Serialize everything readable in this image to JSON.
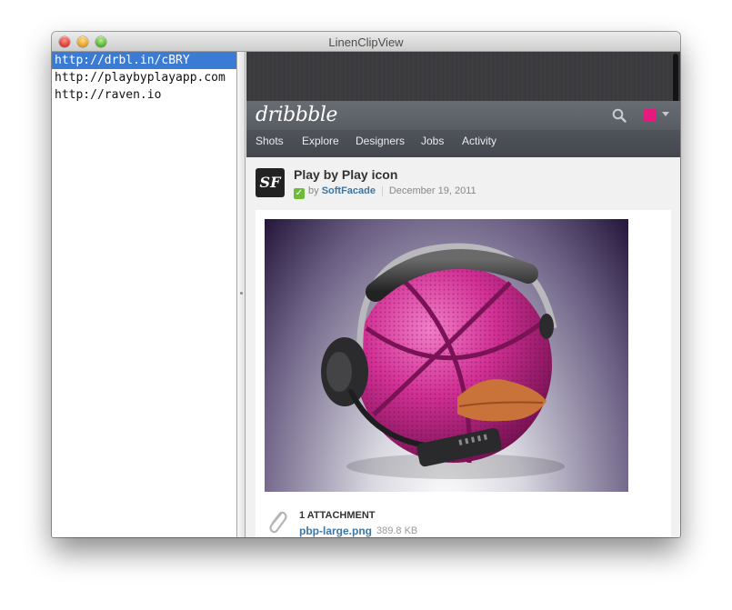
{
  "window": {
    "title": "LinenClipView"
  },
  "colors": {
    "selection": "#3b7bd4",
    "dribbble_pink": "#e6197e",
    "link_blue": "#3b76a5",
    "check_green": "#6dbb3a"
  },
  "sidebar": {
    "urls": [
      {
        "text": "http://drbl.in/cBRY",
        "selected": true
      },
      {
        "text": "http://playbyplayapp.com",
        "selected": false
      },
      {
        "text": "http://raven.io",
        "selected": false
      }
    ]
  },
  "dribbble": {
    "logo": "dribbble",
    "icons": {
      "search": "search-icon",
      "avatar": "user-avatar",
      "caret": "chevron-down-icon"
    },
    "nav": [
      "Shots",
      "Explore",
      "Designers",
      "Jobs",
      "Activity"
    ],
    "shot": {
      "avatar_text": "SF",
      "title": "Play by Play icon",
      "by": "by",
      "author": "SoftFacade",
      "date": "December 19, 2011"
    },
    "attachments": {
      "count_label": "1 ATTACHMENT",
      "file": "pbp-large.png",
      "size": "389.8 KB"
    }
  }
}
